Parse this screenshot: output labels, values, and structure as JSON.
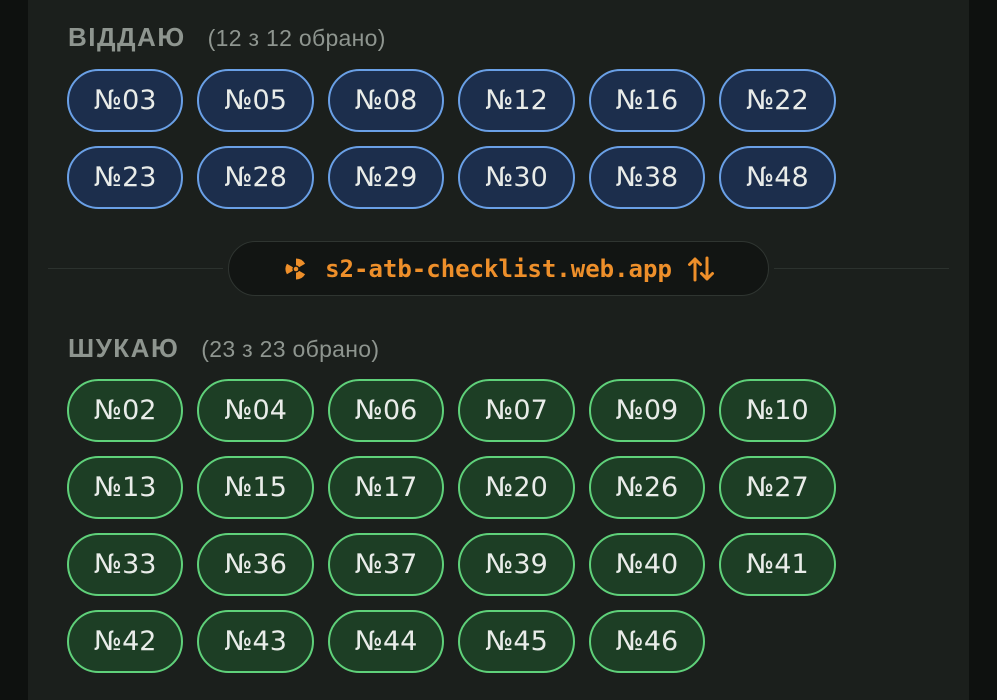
{
  "give": {
    "title": "ВІДДАЮ",
    "count_text": "(12 з 12 обрано)",
    "items": [
      "№03",
      "№05",
      "№08",
      "№12",
      "№16",
      "№22",
      "№23",
      "№28",
      "№29",
      "№30",
      "№38",
      "№48"
    ]
  },
  "link": {
    "text": "s2-atb-checklist.web.app",
    "left_icon": "radiation-icon",
    "right_icon": "swap-arrows-icon",
    "color": "#ee8f2a"
  },
  "seek": {
    "title": "ШУКАЮ",
    "count_text": "(23 з 23 обрано)",
    "items": [
      "№02",
      "№04",
      "№06",
      "№07",
      "№09",
      "№10",
      "№13",
      "№15",
      "№17",
      "№20",
      "№26",
      "№27",
      "№33",
      "№36",
      "№37",
      "№39",
      "№40",
      "№41",
      "№42",
      "№43",
      "№44",
      "№45",
      "№46"
    ]
  },
  "colors": {
    "background": "#1b1f1c",
    "give_fill": "#1c2e4c",
    "give_border": "#6aa0e6",
    "seek_fill": "#1d3e25",
    "seek_border": "#5fd17a",
    "header_text": "#8e958f"
  }
}
